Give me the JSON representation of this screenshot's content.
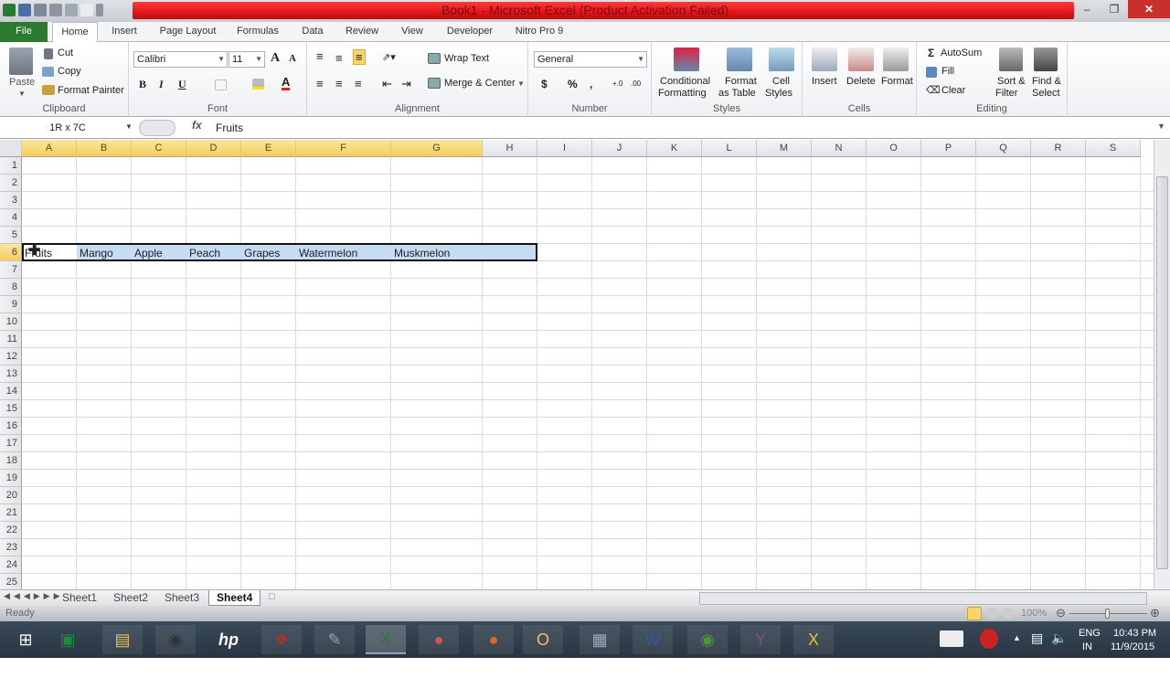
{
  "window": {
    "title": "Book1 - Microsoft Excel (Product Activation Failed)",
    "title_bar_color": "#e3141a",
    "controls": {
      "minimize": "–",
      "restore": "❐",
      "close": "✕"
    }
  },
  "ribbon_tabs": [
    "File",
    "Home",
    "Insert",
    "Page Layout",
    "Formulas",
    "Data",
    "Review",
    "View",
    "Developer",
    "Nitro Pro 9"
  ],
  "active_tab": "Home",
  "ribbon": {
    "clipboard": {
      "label": "Clipboard",
      "paste": "Paste",
      "cut": "Cut",
      "copy": "Copy",
      "format_painter": "Format Painter"
    },
    "font": {
      "label": "Font",
      "name": "Calibri",
      "size": "11",
      "bold": "B",
      "italic": "I",
      "underline": "U",
      "grow": "A",
      "shrink": "A"
    },
    "alignment": {
      "label": "Alignment",
      "wrap_text": "Wrap Text",
      "merge_center": "Merge & Center"
    },
    "number": {
      "label": "Number",
      "format": "General",
      "currency": "$",
      "percent": "%",
      "comma": ",",
      "inc_decimal": "+.0",
      "dec_decimal": ".00"
    },
    "styles": {
      "label": "Styles",
      "conditional": "Conditional",
      "conditional2": "Formatting",
      "format_table": "Format",
      "format_table2": "as Table",
      "cell_styles": "Cell",
      "cell_styles2": "Styles"
    },
    "cells": {
      "label": "Cells",
      "insert": "Insert",
      "delete": "Delete",
      "format": "Format"
    },
    "editing": {
      "label": "Editing",
      "autosum": "AutoSum",
      "fill": "Fill",
      "clear": "Clear",
      "sort": "Sort &",
      "sort2": "Filter",
      "find": "Find &",
      "find2": "Select"
    }
  },
  "formula_bar": {
    "name_box": "1R x 7C",
    "fx": "fx",
    "value": "Fruits"
  },
  "columns": [
    "A",
    "B",
    "C",
    "D",
    "E",
    "F",
    "G",
    "H",
    "I",
    "J",
    "K",
    "L",
    "M",
    "N",
    "O",
    "P",
    "Q",
    "R",
    "S"
  ],
  "selected_columns": [
    "A",
    "B",
    "C",
    "D",
    "E",
    "F",
    "G"
  ],
  "rows": [
    "1",
    "2",
    "3",
    "4",
    "5",
    "6",
    "7",
    "8",
    "9",
    "10",
    "11",
    "12",
    "13",
    "14",
    "15",
    "16",
    "17",
    "18",
    "19",
    "20",
    "21",
    "22",
    "23",
    "24",
    "25"
  ],
  "selected_row": "6",
  "cells_row6": [
    "Fruits",
    "Mango",
    "Apple",
    "Peach",
    "Grapes",
    "Watermelon",
    "Muskmelon"
  ],
  "sheets": [
    "Sheet1",
    "Sheet2",
    "Sheet3",
    "Sheet4"
  ],
  "active_sheet": "Sheet4",
  "status": {
    "mode": "Ready",
    "zoom": "100%"
  },
  "taskbar": {
    "apps": [
      "Start",
      "Store",
      "File Explorer",
      "Webcam",
      "HP",
      "Photos",
      "Notepad",
      "Excel",
      "Media",
      "Firefox",
      "Outlook",
      "Calculator",
      "Word",
      "Chrome",
      "Yahoo Messenger",
      "Xilisoft"
    ],
    "language": "ENG",
    "region": "IN",
    "time": "10:43 PM",
    "date": "11/9/2015"
  }
}
